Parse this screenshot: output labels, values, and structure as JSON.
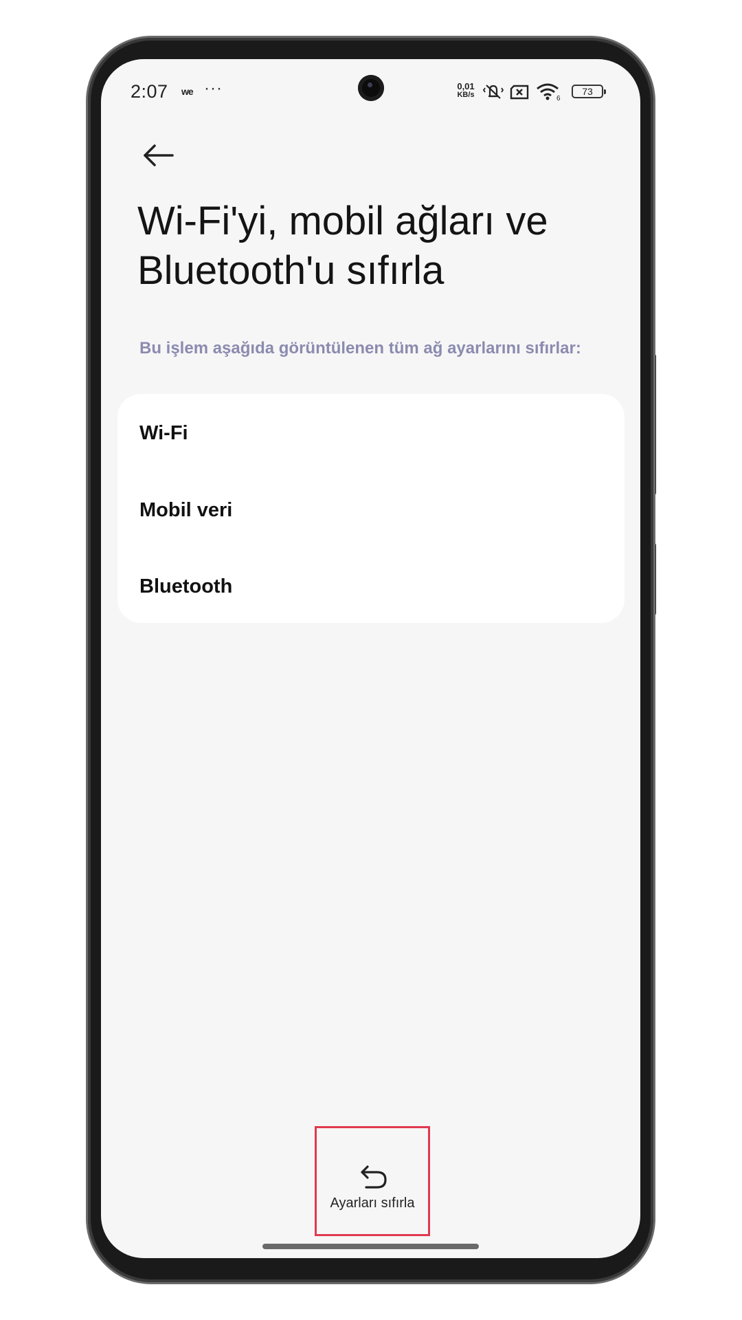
{
  "status_bar": {
    "time": "2:07",
    "carrier_glyph": "we",
    "more_glyph": "···",
    "net_speed_value": "0,01",
    "net_speed_unit": "KB/s",
    "wifi_badge": "6",
    "battery_level": "73",
    "icons": [
      "mute-vibrate-icon",
      "no-sim-icon",
      "wifi-icon",
      "battery-icon"
    ]
  },
  "header": {
    "back_icon": "arrow-left-icon",
    "title": "Wi-Fi'yi, mobil ağları ve Bluetooth'u sıfırla"
  },
  "description": "Bu işlem aşağıda görüntülenen tüm ağ ayarlarını sıfırlar:",
  "reset_items": [
    {
      "label": "Wi-Fi"
    },
    {
      "label": "Mobil veri"
    },
    {
      "label": "Bluetooth"
    }
  ],
  "action": {
    "label": "Ayarları sıfırla",
    "icon": "undo-arrow-icon",
    "highlight_color": "#e0394f"
  },
  "colors": {
    "screen_background": "#f6f6f6",
    "card_background": "#ffffff",
    "subtitle": "#8b8bb0",
    "frame": "#1a1a1a"
  }
}
